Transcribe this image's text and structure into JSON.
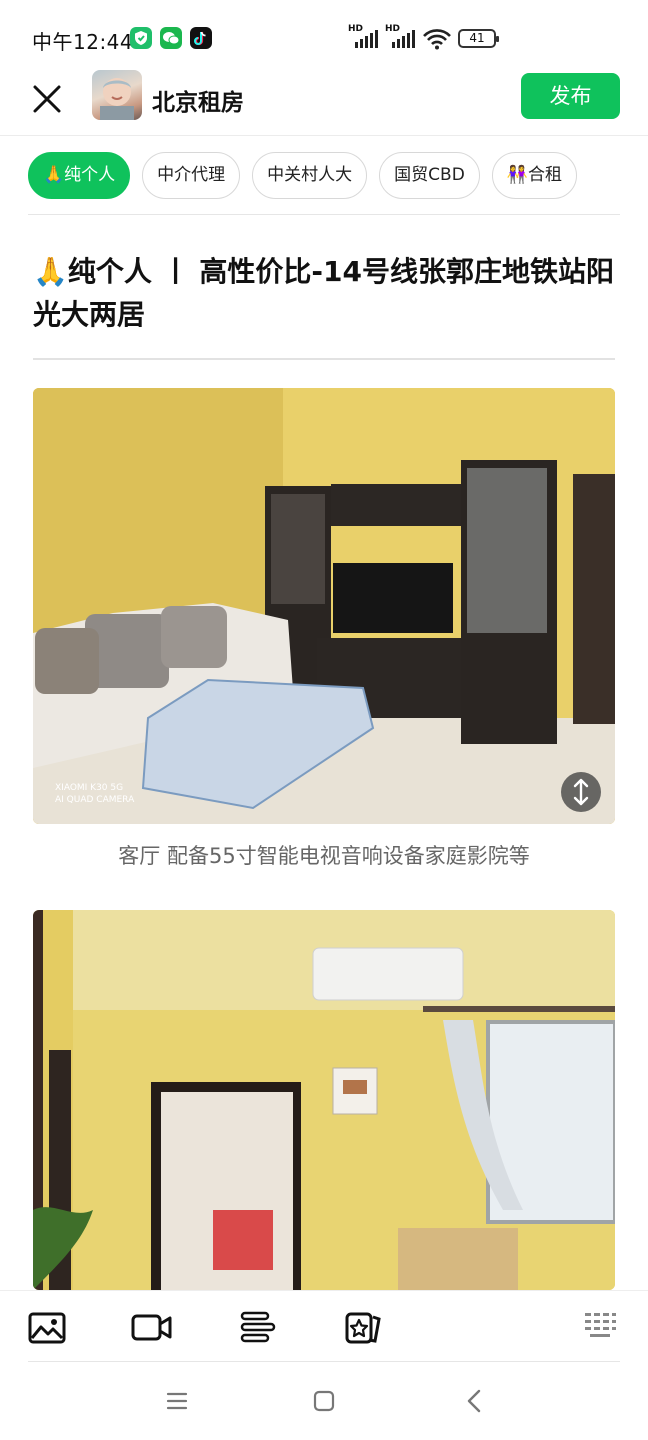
{
  "status_bar": {
    "time": "中午12:44",
    "hd1": "HD",
    "hd2": "HD",
    "battery": "41",
    "app_icons": [
      "shield-app-icon",
      "wechat-icon",
      "tiktok-icon"
    ]
  },
  "header": {
    "title": "北京租房",
    "publish_label": "发布"
  },
  "tags": [
    {
      "label": "🙏纯个人",
      "active": true
    },
    {
      "label": "中介代理",
      "active": false
    },
    {
      "label": "中关村人大",
      "active": false
    },
    {
      "label": "国贸CBD",
      "active": false
    },
    {
      "label": "👭合租",
      "active": false
    }
  ],
  "article": {
    "title": "🙏纯个人 丨 高性价比-14号线张郭庄地铁站阳光大两居",
    "photo1_watermark_line1": "XIAOMI K30 5G",
    "photo1_watermark_line2": "AI QUAD CAMERA",
    "caption1": "客厅 配备55寸智能电视音响设备家庭影院等"
  },
  "toolbar": {
    "items": [
      "image-icon",
      "video-icon",
      "text-align-icon",
      "star-card-icon",
      "keyboard-icon"
    ]
  },
  "colors": {
    "accent": "#0fc25c",
    "wall_yellow": "#e6cc66"
  }
}
